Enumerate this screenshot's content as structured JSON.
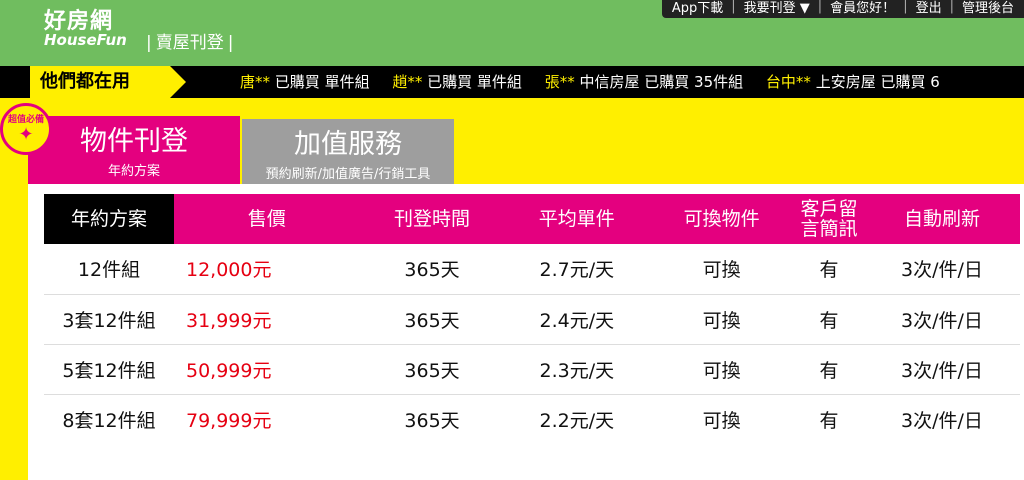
{
  "header": {
    "logo_cn": "好房網",
    "logo_en": "HouseFun",
    "section_title": "賣屋刊登"
  },
  "top_nav": {
    "app_download": "App下載",
    "publish": "我要刊登 ▼",
    "greeting": "會員您好！",
    "logout": "登出",
    "admin": "管理後台"
  },
  "ticker": {
    "label": "他們都在用",
    "items": [
      {
        "name": "唐**",
        "text": "已購買 單件組"
      },
      {
        "name": "趙**",
        "text": "已購買 單件組"
      },
      {
        "name": "張**",
        "text": "中信房屋 已購買 35件組"
      },
      {
        "name": "台中**",
        "text": "上安房屋 已購買 6"
      }
    ]
  },
  "badge": {
    "text": "超值必備",
    "icon": "cheering-person-icon"
  },
  "tabs": [
    {
      "title": "物件刊登",
      "subtitle": "年約方案",
      "active": true
    },
    {
      "title": "加值服務",
      "subtitle": "預約刷新/加值廣告/行銷工具",
      "active": false
    }
  ],
  "table": {
    "headers": [
      "年約方案",
      "售價",
      "刊登時間",
      "平均單件",
      "可換物件",
      "客戶留言簡訊",
      "自動刷新"
    ],
    "rows": [
      [
        "12件組",
        "12,000元",
        "365天",
        "2.7元/天",
        "可換",
        "有",
        "3次/件/日"
      ],
      [
        "3套12件組",
        "31,999元",
        "365天",
        "2.4元/天",
        "可換",
        "有",
        "3次/件/日"
      ],
      [
        "5套12件組",
        "50,999元",
        "365天",
        "2.3元/天",
        "可換",
        "有",
        "3次/件/日"
      ],
      [
        "8套12件組",
        "79,999元",
        "365天",
        "2.2元/天",
        "可換",
        "有",
        "3次/件/日"
      ]
    ]
  },
  "colors": {
    "brand_green": "#70bd5f",
    "accent_magenta": "#e4007f",
    "background_yellow": "#ffef00",
    "price_red": "#e60012"
  }
}
